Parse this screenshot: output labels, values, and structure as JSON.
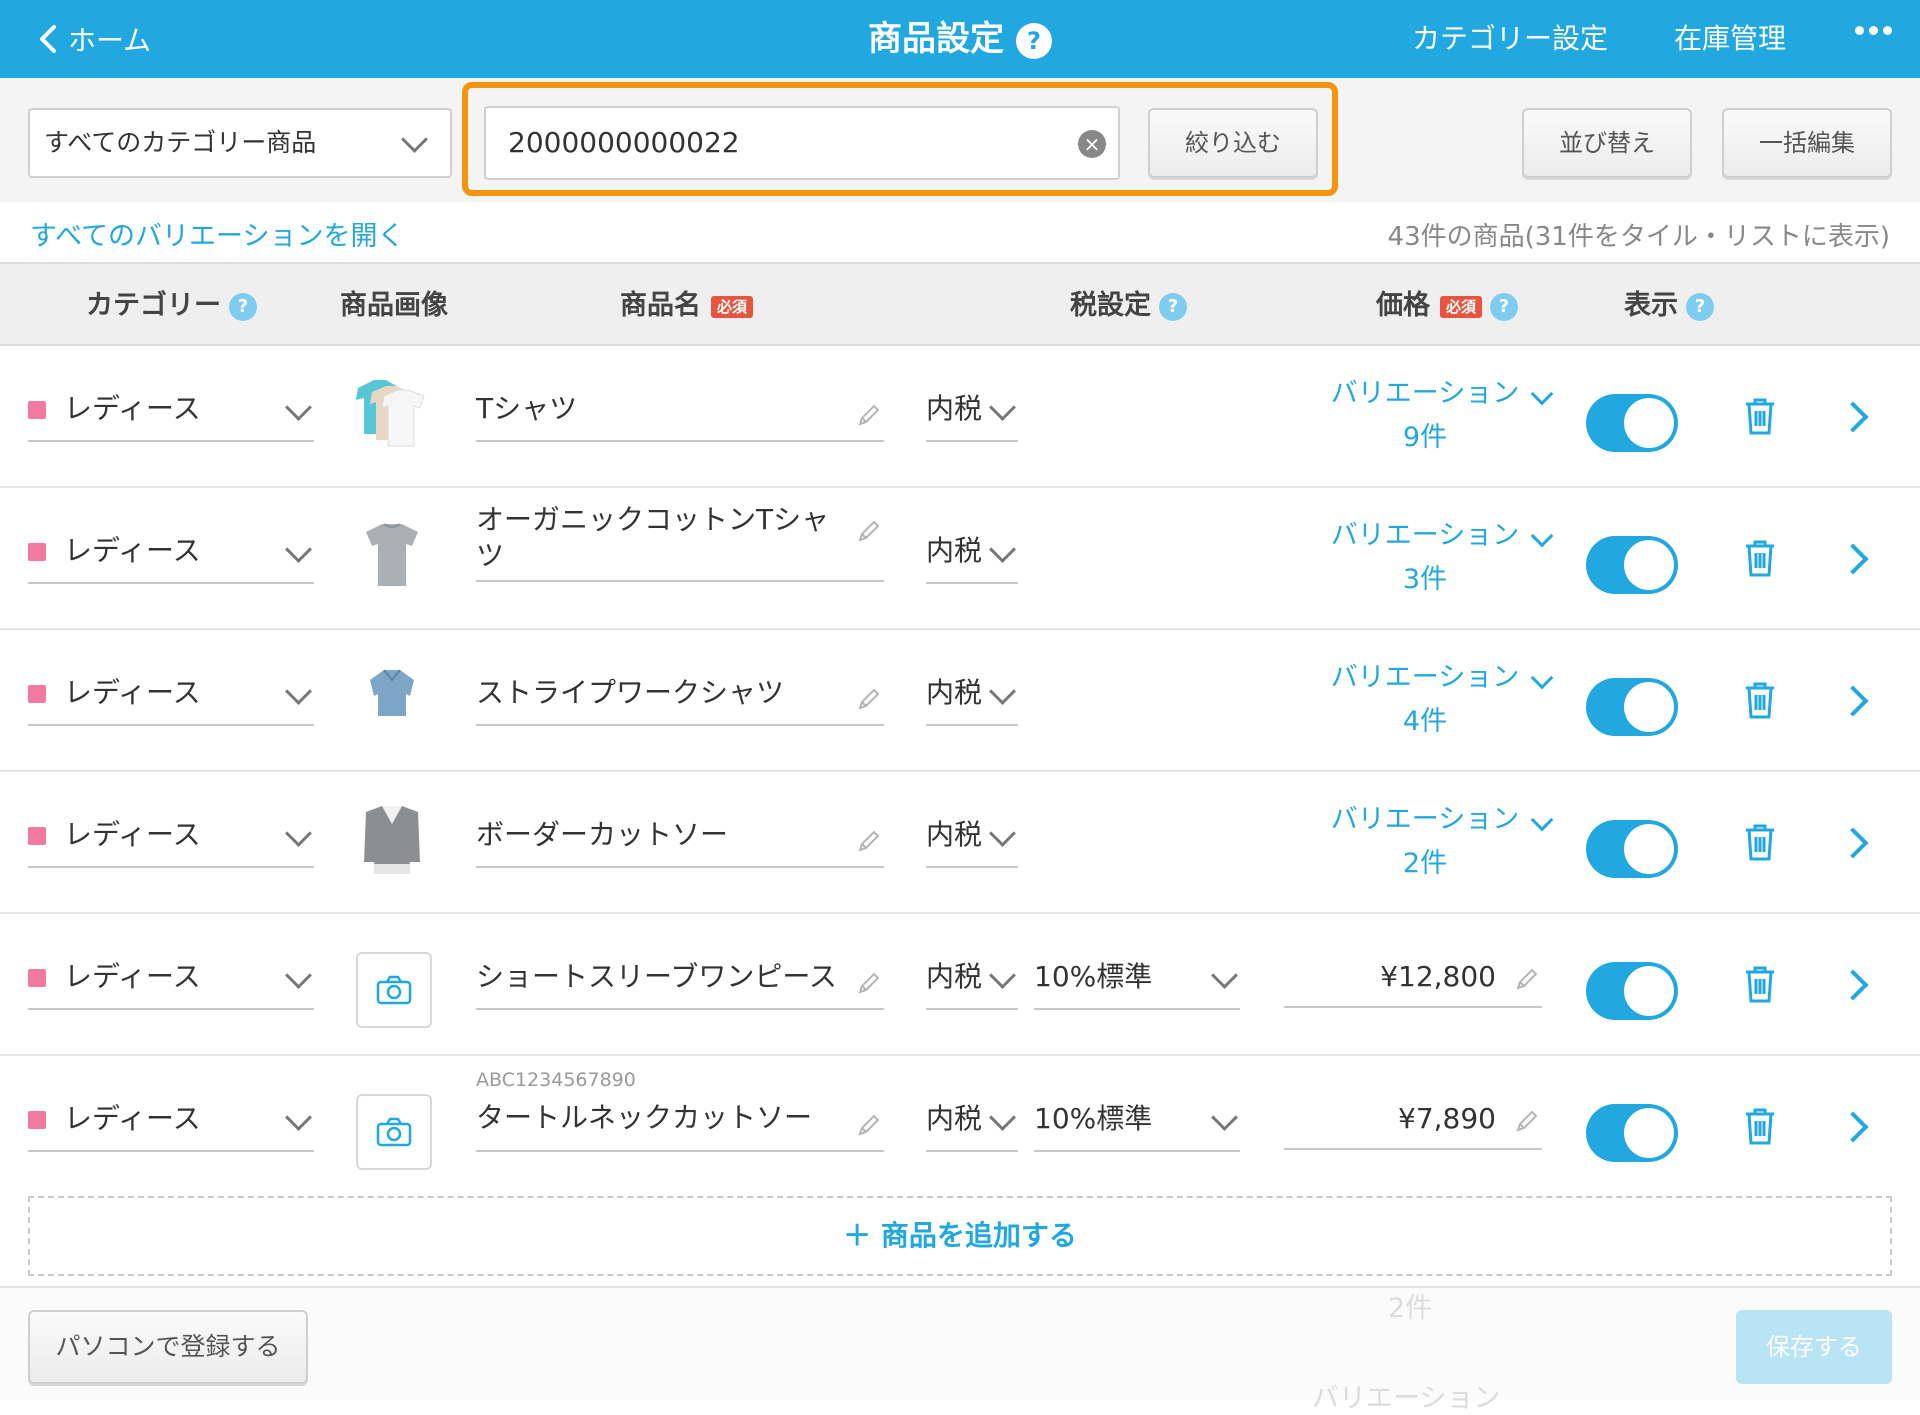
{
  "header": {
    "back_label": "ホーム",
    "title": "商品設定",
    "help": "?",
    "links": [
      "カテゴリー設定",
      "在庫管理"
    ],
    "color": "#22a8e0"
  },
  "toolbar": {
    "category_filter": "すべてのカテゴリー商品",
    "search_value": "2000000000022",
    "filter_button": "絞り込む",
    "sort_button": "並び替え",
    "bulk_edit_button": "一括編集",
    "highlight_color": "#f5940e"
  },
  "subbar": {
    "open_all": "すべてのバリエーションを開く",
    "count": "43件の商品(31件をタイル・リストに表示)"
  },
  "table": {
    "columns": {
      "category": "カテゴリー",
      "image": "商品画像",
      "name": "商品名",
      "tax": "税設定",
      "price": "価格",
      "display": "表示"
    },
    "required_badge": "必須",
    "rows": [
      {
        "category": "レディース",
        "image": "tshirt-stack",
        "name": "Tシャツ",
        "code": "",
        "tax": "内税",
        "tax_rate": "",
        "variation_label": "バリエーション",
        "variation_count": "9件",
        "price": "",
        "display_on": true
      },
      {
        "category": "レディース",
        "image": "gray-tshirt",
        "name": "オーガニックコットンTシャツ",
        "code": "",
        "tax": "内税",
        "tax_rate": "",
        "variation_label": "バリエーション",
        "variation_count": "3件",
        "price": "",
        "display_on": true
      },
      {
        "category": "レディース",
        "image": "blue-shirt",
        "name": "ストライプワークシャツ",
        "code": "",
        "tax": "内税",
        "tax_rate": "",
        "variation_label": "バリエーション",
        "variation_count": "4件",
        "price": "",
        "display_on": true
      },
      {
        "category": "レディース",
        "image": "border-sweater",
        "name": "ボーダーカットソー",
        "code": "",
        "tax": "内税",
        "tax_rate": "",
        "variation_label": "バリエーション",
        "variation_count": "2件",
        "price": "",
        "display_on": true
      },
      {
        "category": "レディース",
        "image": "camera-placeholder",
        "name": "ショートスリーブワンピース",
        "code": "",
        "tax": "内税",
        "tax_rate": "10%標準",
        "variation_label": "",
        "variation_count": "",
        "price": "¥12,800",
        "display_on": true
      },
      {
        "category": "レディース",
        "image": "camera-placeholder",
        "name": "タートルネックカットソー",
        "code": "ABC1234567890",
        "tax": "内税",
        "tax_rate": "10%標準",
        "variation_label": "",
        "variation_count": "",
        "price": "¥7,890",
        "display_on": true
      }
    ]
  },
  "add_product": "＋ 商品を追加する",
  "footer": {
    "register_pc": "パソコンで登録する",
    "save": "保存する",
    "ghost_count": "2件",
    "ghost_variation": "バリエーション"
  }
}
